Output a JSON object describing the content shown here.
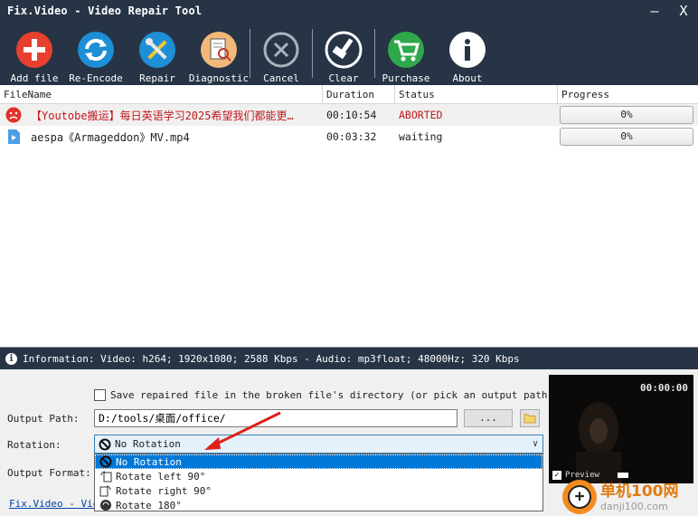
{
  "window": {
    "title": "Fix.Video - Video Repair Tool",
    "minimize_glyph": "—",
    "close_glyph": "X"
  },
  "toolbar": {
    "buttons": [
      {
        "label": "Add file",
        "icon": "add-icon"
      },
      {
        "label": "Re-Encode",
        "icon": "reencode-icon"
      },
      {
        "label": "Repair",
        "icon": "repair-tools-icon"
      },
      {
        "label": "Diagnostic",
        "icon": "diagnostic-icon"
      },
      {
        "label": "Cancel",
        "icon": "cancel-icon"
      },
      {
        "label": "Clear",
        "icon": "clear-broom-icon"
      },
      {
        "label": "Purchase",
        "icon": "cart-icon"
      },
      {
        "label": "About",
        "icon": "info-icon"
      }
    ]
  },
  "table": {
    "headers": {
      "name": "FileName",
      "duration": "Duration",
      "status": "Status",
      "progress": "Progress"
    },
    "rows": [
      {
        "name": "【Youtobe搬运】每日英语学习2025希望我们都能更…",
        "duration": "00:10:54",
        "status": "ABORTED",
        "progress": "0%",
        "icon": "error-face-icon"
      },
      {
        "name": "aespa《Armageddon》MV.mp4",
        "duration": "00:03:32",
        "status": "waiting",
        "progress": "0%",
        "icon": "video-file-icon"
      }
    ]
  },
  "info": {
    "text": "Information: Video: h264; 1920x1080; 2588 Kbps - Audio: mp3float; 48000Hz; 320 Kbps"
  },
  "options": {
    "save_checkbox_label": "Save repaired file in the broken file's directory (or pick an output path below)",
    "output_path_label": "Output Path:",
    "output_path_value": "D:/tools/桌面/office/",
    "browse_label": "...",
    "rotation_label": "Rotation:",
    "rotation_selected": "No Rotation",
    "rotation_options": [
      "No Rotation",
      "Rotate left 90°",
      "Rotate right 90°",
      "Rotate 180°"
    ],
    "output_format_label": "Output Format:"
  },
  "footer": {
    "link_text": "Fix.Video - Video Repair Tool"
  },
  "preview": {
    "time": "00:00:00",
    "checkbox_label": "Preview"
  },
  "watermark": {
    "line1": "单机100网",
    "line2": "danji100.com"
  },
  "colors": {
    "dark_bar": "#263445",
    "aborted": "#c0181c",
    "selection": "#0078d7"
  }
}
